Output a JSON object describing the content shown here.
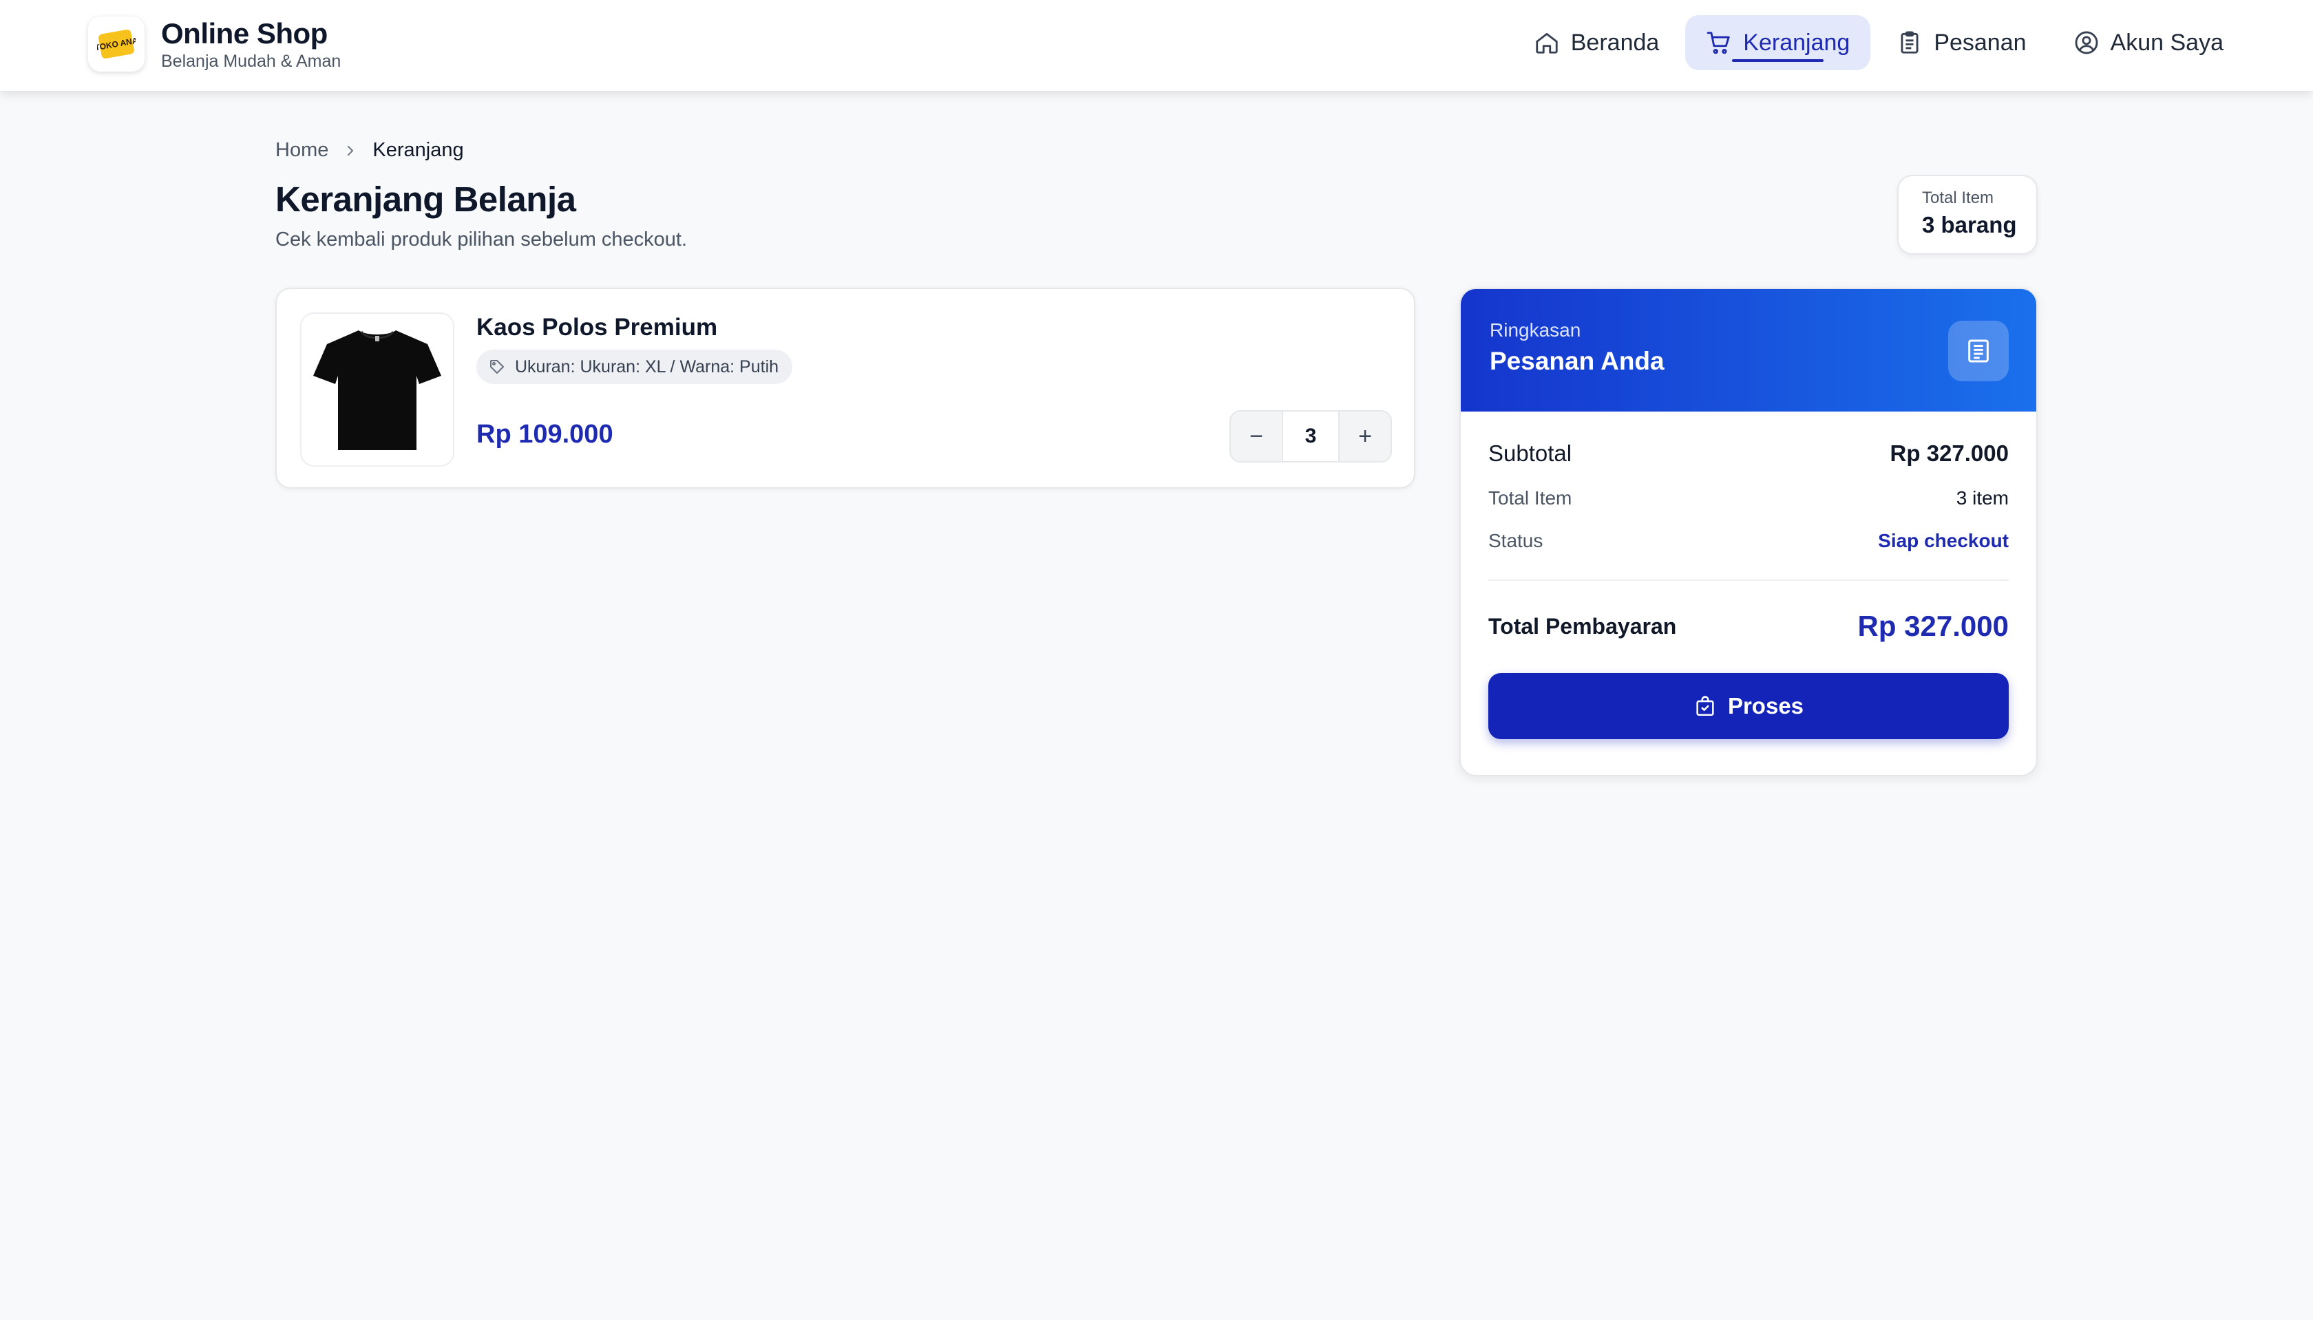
{
  "brand": {
    "title": "Online Shop",
    "subtitle": "Belanja Mudah & Aman",
    "logo_text": "TOKO ANA"
  },
  "nav": [
    {
      "label": "Beranda",
      "icon": "home-icon",
      "active": false
    },
    {
      "label": "Keranjang",
      "icon": "cart-icon",
      "active": true
    },
    {
      "label": "Pesanan",
      "icon": "clipboard-icon",
      "active": false
    },
    {
      "label": "Akun Saya",
      "icon": "user-circle-icon",
      "active": false
    }
  ],
  "breadcrumb": {
    "home": "Home",
    "current": "Keranjang"
  },
  "page": {
    "title": "Keranjang Belanja",
    "subtitle": "Cek kembali produk pilihan sebelum checkout."
  },
  "total_badge": {
    "label": "Total Item",
    "value": "3 barang"
  },
  "cart": {
    "items": [
      {
        "name": "Kaos Polos Premium",
        "variant": "Ukuran: Ukuran: XL / Warna: Putih",
        "price": "Rp 109.000",
        "quantity": "3",
        "minus": "−",
        "plus": "+"
      }
    ]
  },
  "summary": {
    "label": "Ringkasan",
    "title": "Pesanan Anda",
    "subtotal_label": "Subtotal",
    "subtotal_value": "Rp 327.000",
    "total_item_label": "Total Item",
    "total_item_value": "3 item",
    "status_label": "Status",
    "status_value": "Siap checkout",
    "total_label": "Total Pembayaran",
    "total_value": "Rp 327.000",
    "button_label": "Proses"
  },
  "colors": {
    "accent": "#1e2bb0",
    "button": "#1424b8",
    "header_gradient_start": "#1535cc",
    "header_gradient_end": "#1a70ec"
  }
}
